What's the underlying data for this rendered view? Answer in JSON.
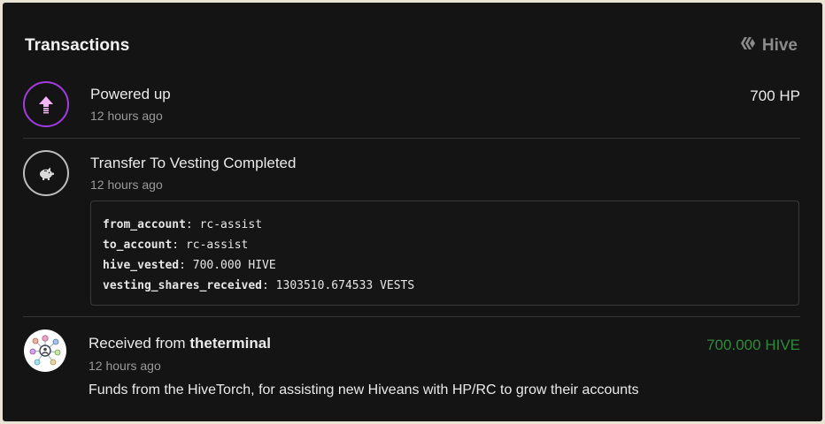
{
  "header": {
    "title": "Transactions",
    "brand_label": "Hive",
    "brand_icon": "hive-logo-icon"
  },
  "transactions": [
    {
      "title": "Powered up",
      "time": "12 hours ago",
      "amount": "700 HP",
      "icon": "power-up-arrow-icon",
      "accent": "#a23be0"
    },
    {
      "title": "Transfer To Vesting Completed",
      "time": "12 hours ago",
      "icon": "piggy-bank-icon",
      "details": [
        {
          "key": "from_account",
          "value": "rc-assist"
        },
        {
          "key": "to_account",
          "value": "rc-assist"
        },
        {
          "key": "hive_vested",
          "value": "700.000 HIVE"
        },
        {
          "key": "vesting_shares_received",
          "value": "1303510.674533 VESTS"
        }
      ]
    },
    {
      "title_prefix": "Received from ",
      "title_user": "theterminal",
      "time": "12 hours ago",
      "amount": "700.000 HIVE",
      "amount_color": "#2f8a3a",
      "memo": "Funds from the HiveTorch, for assisting new Hiveans with HP/RC to grow their accounts",
      "icon": "network-avatar-icon"
    }
  ],
  "colors": {
    "background": "#141414",
    "frame": "#e9e4d3",
    "divider": "#343434"
  }
}
